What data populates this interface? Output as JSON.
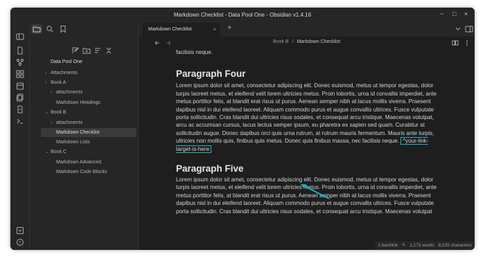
{
  "window": {
    "title": "Markdown Checklist - Data Pool One - Obsidian v1.4.16"
  },
  "sidebar": {
    "vault_name": "Data Pool One",
    "items": [
      {
        "label": "Attachments",
        "chevron": "›"
      },
      {
        "label": "Book A",
        "chevron": "›"
      },
      {
        "label": "attachments",
        "chevron": "›"
      },
      {
        "label": "Markdown Headings",
        "chevron": ""
      },
      {
        "label": "Book B",
        "chevron": "›"
      },
      {
        "label": "attachments",
        "chevron": "›"
      },
      {
        "label": "Markdown Checklist",
        "chevron": ""
      },
      {
        "label": "Markdown Lists",
        "chevron": ""
      },
      {
        "label": "Book C",
        "chevron": "›"
      },
      {
        "label": "Markdown Advanced",
        "chevron": ""
      },
      {
        "label": "Markdown Code Blocks",
        "chevron": ""
      }
    ]
  },
  "tabs": {
    "active_label": "Markdown Checklist",
    "add": "+",
    "close": "×"
  },
  "breadcrumb": {
    "parent": "Book B",
    "sep": "/",
    "current": "Markdown Checklist"
  },
  "note": {
    "top_fragment": "facilisis neque.",
    "heading_four": "Paragraph Four",
    "para_four": "Lorem ipsum dolor sit amet, consectetur adipiscing elit. Donec euismod, metus ut tempor egestas, dolor turpis laoreet metus, et eleifend velit lorem ultricies metus. Proin lobortis, urna id convallis imperdiet, ante metus porttitor felis, at blandit erat risus ut purus. Aenean semper nibh at lacus mollis viverra. Praesent dapibus nisl in dui eleifend laoreet. Aliquam commodo purus et augue convallis ultrices. Fusce vulputate porta sollicitudin. Cras blandit dui ultricies risus sodales, et consequat arcu tristique. Maecenas volutpat, arcu ac accumsan cursus, lacus lectus semper ipsum, eu pharetra ex sapien sed quam. Curabitur at sollicitudin augue. Donec dapibus orci quis urna rutrum, at rutrum mauris fermentum. Mauris ante turpis, ultricies non mollis quis, finibus quis metus. Donec quis finibus massa, nec facilisis neque.",
    "link_target": "^your-link-target-is-here",
    "heading_five": "Paragraph Five",
    "para_five": "Lorem ipsum dolor sit amet, consectetur adipiscing elit. Donec euismod, metus ut tempor egestas, dolor turpis laoreet metus, et eleifend velit lorem ultricies metus. Proin lobortis, urna id convallis imperdiet, ante metus porttitor felis, at blandit erat risus ut purus. Aenean semper nibh at lacus mollis viverra. Praesent dapibus nisl in dui eleifend laoreet. Aliquam commodo purus et augue convallis ultrices. Fusce vulputate porta sollicitudin. Cras blandit dui ultricies risus sodales, et consequat arcu tristique. Maecenas volutpat"
  },
  "status": {
    "backlinks": "1 backlink",
    "words": "1,173 words",
    "chars": "8,025 characters"
  },
  "colors": {
    "accent": "#19b7c8",
    "bg": "#1e1e1e",
    "panel": "#262626"
  }
}
